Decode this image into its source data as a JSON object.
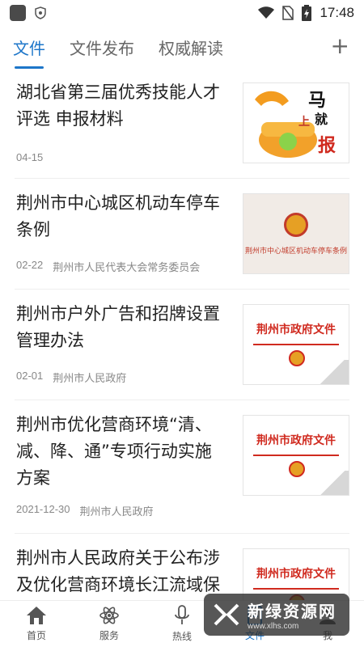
{
  "status_bar": {
    "time": "17:48"
  },
  "tabs": [
    {
      "label": "文件",
      "active": true
    },
    {
      "label": "文件发布",
      "active": false
    },
    {
      "label": "权威解读",
      "active": false
    }
  ],
  "tab_add_label": "+",
  "items": [
    {
      "title": "湖北省第三届优秀技能人才评选 申报材料",
      "date": "04-15",
      "source": "",
      "thumb": "phone-image"
    },
    {
      "title": "荆州市中心城区机动车停车条例",
      "date": "02-22",
      "source": "荆州市人民代表大会常务委员会",
      "thumb": "law-document",
      "thumb_text": "荆州市中心城区机动车停车条例"
    },
    {
      "title": "荆州市户外广告和招牌设置管理办法",
      "date": "02-01",
      "source": "荆州市人民政府",
      "thumb": "gov-document",
      "thumb_text": "荆州市政府文件"
    },
    {
      "title": "荆州市优化营商环境“清、减、降、通”专项行动实施方案",
      "date": "2021-12-30",
      "source": "荆州市人民政府",
      "thumb": "gov-document",
      "thumb_text": "荆州市政府文件"
    },
    {
      "title": "荆州市人民政府关于公布涉及优化营商环境长江流域保",
      "date": "",
      "source": "",
      "thumb": "gov-document",
      "thumb_text": "荆州市政府文件"
    }
  ],
  "bottom_nav": [
    {
      "label": "首页",
      "icon": "home-icon"
    },
    {
      "label": "服务",
      "icon": "atom-icon"
    },
    {
      "label": "热线",
      "icon": "microphone-icon"
    },
    {
      "label": "文件",
      "icon": "document-icon",
      "active": true
    },
    {
      "label": "我",
      "icon": "user-icon"
    }
  ],
  "watermark": {
    "main": "新绿资源网",
    "sub": "www.xlhs.com"
  },
  "colors": {
    "accent": "#1d76c9",
    "gov_red": "#d02a1f"
  }
}
